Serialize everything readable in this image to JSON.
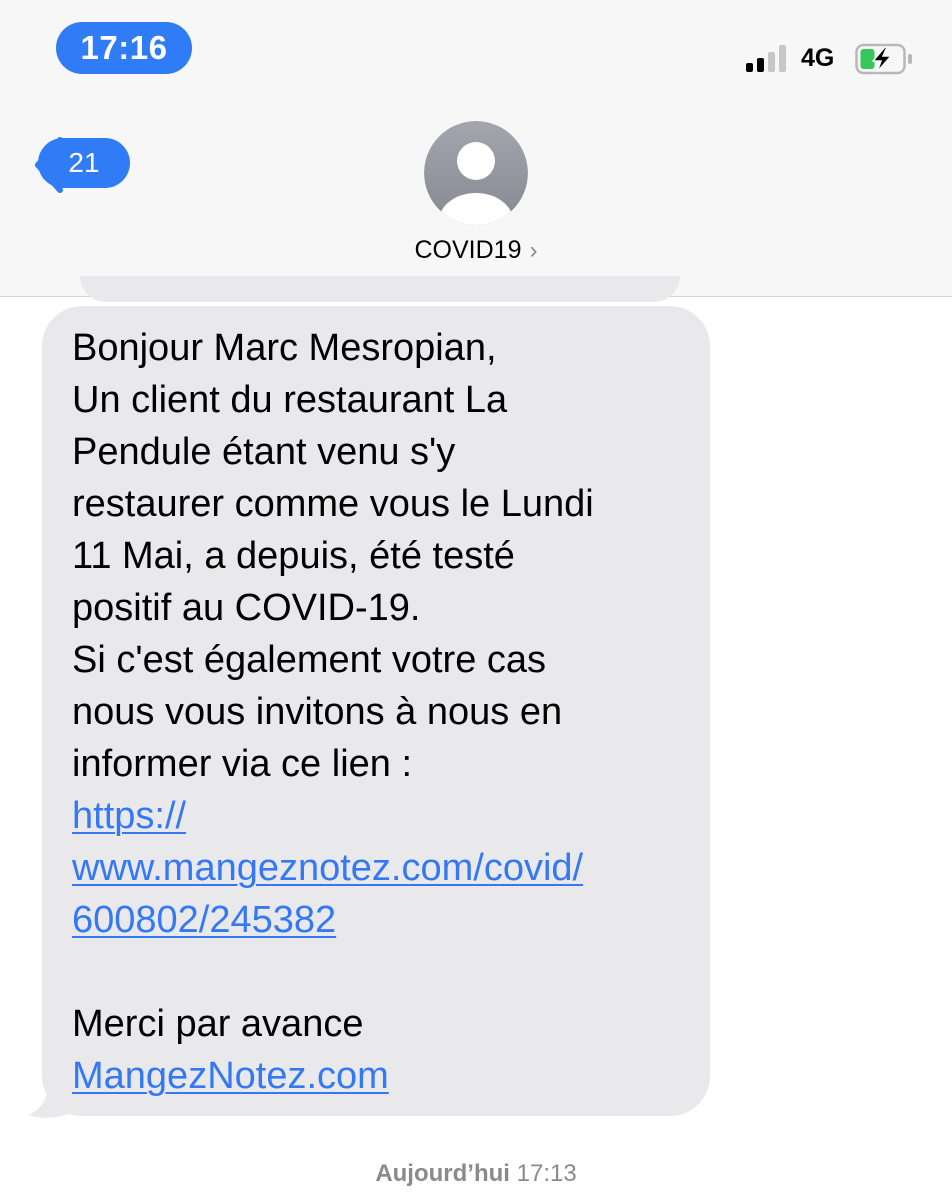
{
  "status_bar": {
    "time": "17:16",
    "network": "4G",
    "signal_bars_active": 2,
    "signal_bars_total": 4,
    "battery_charging": true,
    "accent_color": "#2f7cf6"
  },
  "nav": {
    "back_icon": "chevron-left-icon",
    "unread_count": "21",
    "contact_icon": "person-icon",
    "contact_name": "COVID19",
    "contact_chevron": "›"
  },
  "message": {
    "lines": [
      "Bonjour Marc Mesropian,",
      "Un client du restaurant La",
      "Pendule étant venu s'y",
      "restaurer comme vous le Lundi",
      "11 Mai, a depuis, été testé",
      "positif au COVID-19.",
      "Si c'est également votre cas",
      "nous vous invitons à nous en",
      "informer via ce lien :"
    ],
    "link_lines": [
      "https://",
      "www.mangeznotez.com/covid/",
      "600802/245382"
    ],
    "closing": "Merci par avance",
    "signature_link": "MangezNotez.com",
    "link_color": "#3478f6",
    "bubble_color": "#e9e9eb"
  },
  "footer": {
    "day": "Aujourd’hui",
    "time": "17:13"
  }
}
